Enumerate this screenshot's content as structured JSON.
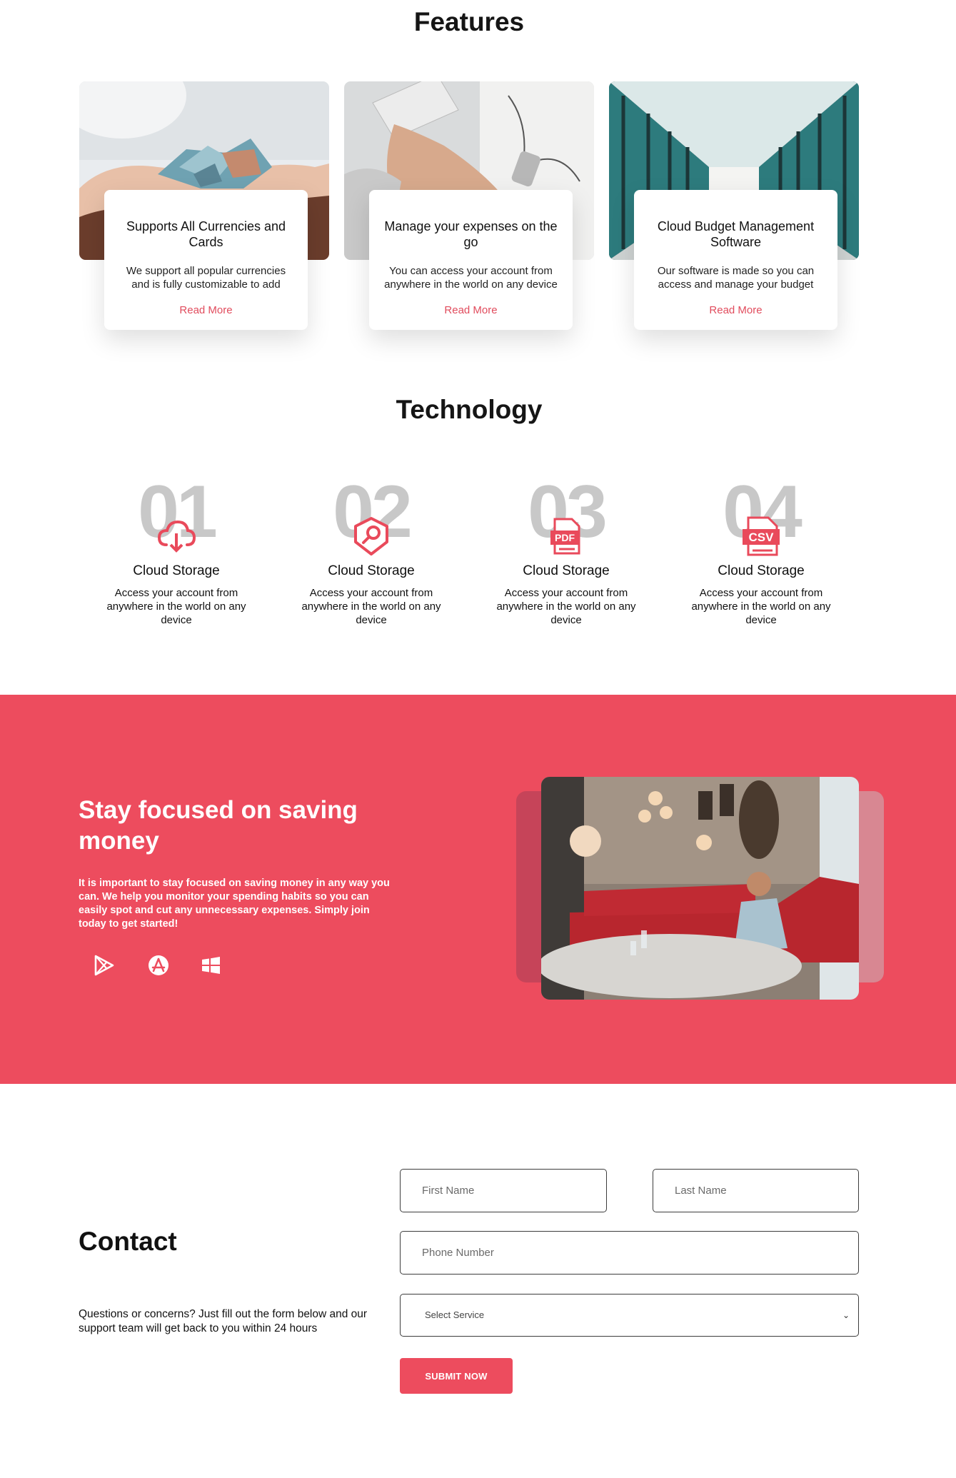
{
  "features": {
    "title": "Features",
    "cards": [
      {
        "title": "Supports All Currencies and Cards",
        "desc": "We support all popular currencies and is fully customizable to add",
        "link": "Read More"
      },
      {
        "title": "Manage your expenses on the go",
        "desc": "You can access your account from anywhere in the world on any device",
        "link": "Read More"
      },
      {
        "title": "Cloud Budget Management Software",
        "desc": "Our software is made so you can access and manage your budget",
        "link": "Read More"
      }
    ]
  },
  "technology": {
    "title": "Technology",
    "items": [
      {
        "num": "01",
        "icon": "cloud-download-icon",
        "title": "Cloud Storage",
        "desc": "Access your account from anywhere in the world on any device"
      },
      {
        "num": "02",
        "icon": "shield-search-icon",
        "title": "Cloud Storage",
        "desc": "Access your account from anywhere in the world on any device"
      },
      {
        "num": "03",
        "icon": "pdf-file-icon",
        "title": "Cloud Storage",
        "desc": "Access your account from anywhere in the world on any device"
      },
      {
        "num": "04",
        "icon": "csv-file-icon",
        "title": "Cloud Storage",
        "desc": "Access your account from anywhere in the world on any device"
      }
    ],
    "icon_labels": {
      "pdf": "PDF",
      "csv": "CSV"
    }
  },
  "promo": {
    "title": "Stay focused on saving money",
    "desc": "It is important to stay focused on saving money in any way you can. We help you monitor your spending habits so you can easily spot and cut any unnecessary expenses. Simply join today to get started!",
    "stores": [
      "google-play-icon",
      "app-store-icon",
      "windows-icon"
    ],
    "bg_color": "#ed4c5e"
  },
  "contact": {
    "title": "Contact",
    "desc": "Questions or concerns? Just fill out the form below and our support team will get back to you within 24 hours",
    "first_name_placeholder": "First Name",
    "last_name_placeholder": "Last Name",
    "phone_placeholder": "Phone Number",
    "service_selected": "Select Service",
    "submit_label": "SUBMIT NOW"
  },
  "colors": {
    "accent": "#ed4c5e",
    "number_gray": "#c8c8c8"
  }
}
